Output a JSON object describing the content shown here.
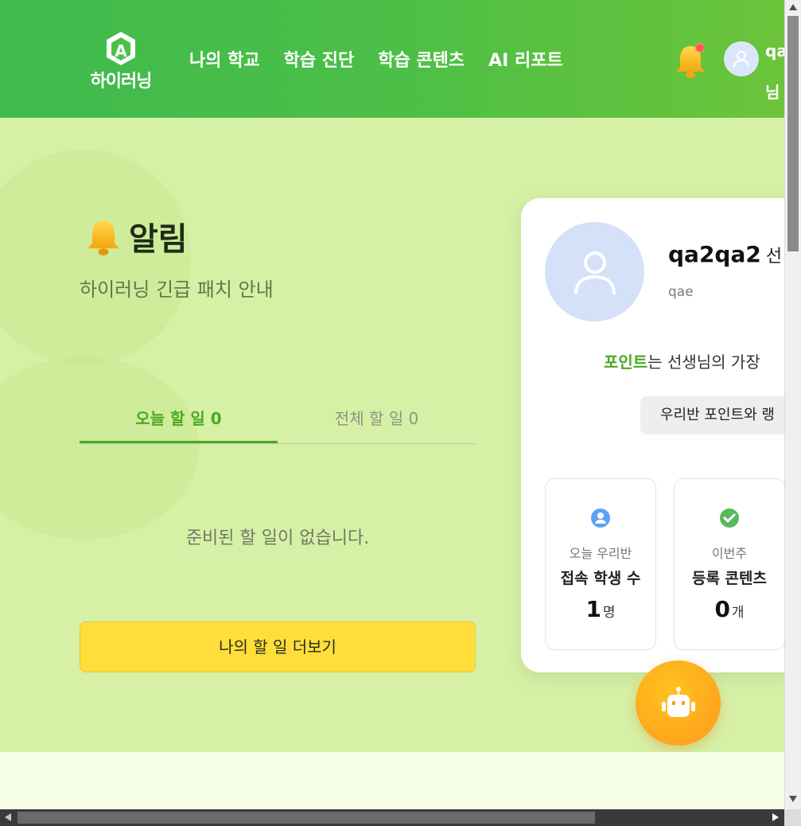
{
  "header": {
    "logo_text": "하이러닝",
    "nav": [
      "나의 학교",
      "학습 진단",
      "학습 콘텐츠",
      "AI 리포트"
    ],
    "user_name_partial_line1": "qa",
    "user_name_partial_line2": "님"
  },
  "notice": {
    "title": "알림",
    "subtitle": "하이러닝 긴급 패치 안내"
  },
  "todo": {
    "tab_today": "오늘 할 일 0",
    "tab_all": "전체 할 일 0",
    "empty_message": "준비된 할 일이 없습니다.",
    "more_button": "나의 할 일 더보기"
  },
  "profile": {
    "name": "qa2qa2",
    "suffix": "선",
    "id": "qae",
    "points_highlight": "포인트",
    "points_text": "는 선생님의 가장",
    "rank_button": "우리반 포인트와 랭",
    "stats": [
      {
        "line1": "오늘 우리반",
        "line2": "접속 학생 수",
        "value": "1",
        "unit": "명",
        "icon": "user-circle-icon"
      },
      {
        "line1": "이번주",
        "line2": "등록 콘텐츠",
        "value": "0",
        "unit": "개",
        "icon": "check-circle-icon"
      }
    ]
  },
  "colors": {
    "header_start": "#3fba4f",
    "header_end": "#6cc43a",
    "main_bg": "#d6f0a6",
    "accent_green": "#4ba821",
    "button_yellow": "#ffde3b",
    "bot_orange": "#ffa81d"
  }
}
